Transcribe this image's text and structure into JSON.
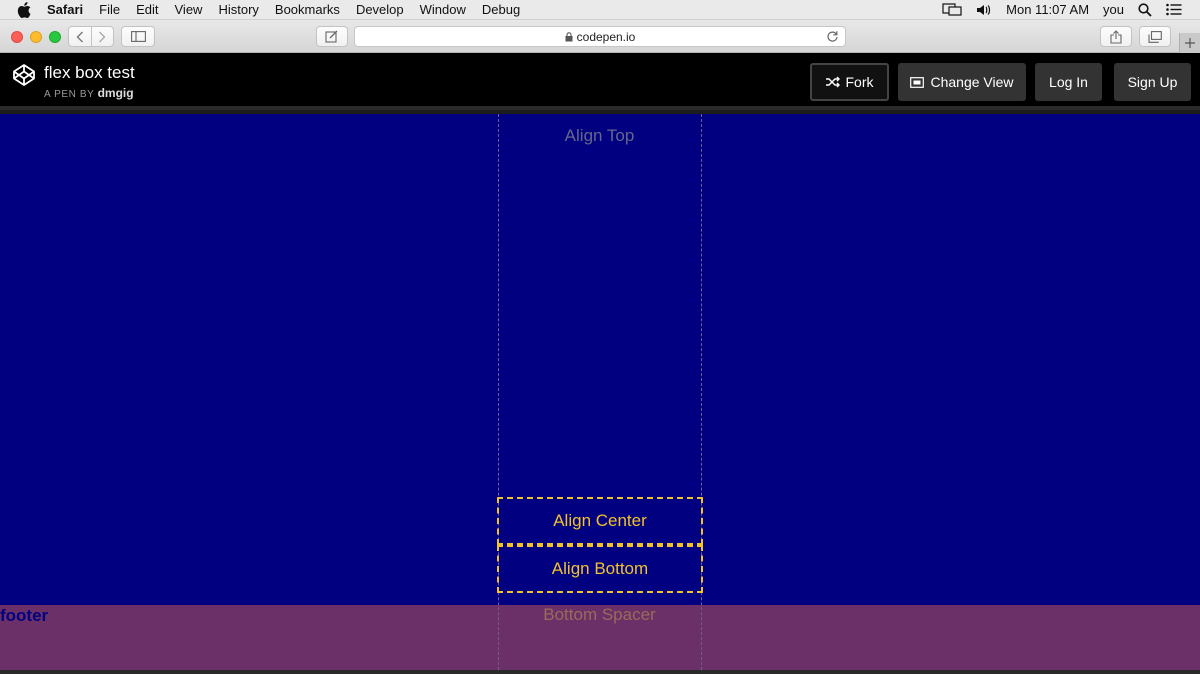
{
  "menubar": {
    "app": "Safari",
    "items": [
      "File",
      "Edit",
      "View",
      "History",
      "Bookmarks",
      "Develop",
      "Window",
      "Debug"
    ],
    "clock": "Mon 11:07 AM",
    "user": "you"
  },
  "browser": {
    "url": "codepen.io"
  },
  "pen": {
    "title": "flex box test",
    "byline_prefix": "A PEN BY",
    "author": "dmgig",
    "buttons": {
      "fork": "Fork",
      "change_view": "Change View",
      "login": "Log In",
      "signup": "Sign Up"
    }
  },
  "result": {
    "align_top": "Align Top",
    "align_center": "Align Center",
    "align_bottom": "Align Bottom",
    "footer": "footer",
    "bottom_spacer": "Bottom Spacer"
  },
  "colors": {
    "result_bg": "#000080",
    "footer_bg": "#6b3068",
    "highlight": "#f2c12e"
  }
}
